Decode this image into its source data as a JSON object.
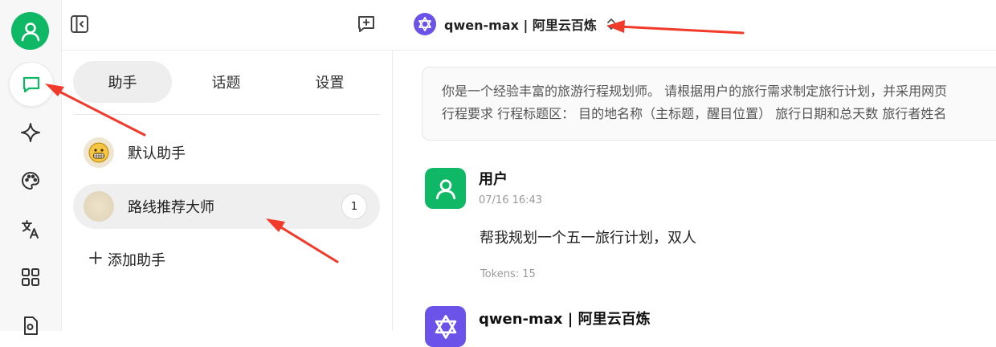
{
  "colors": {
    "brand_green": "#0fb865",
    "model_purple": "#6b52e8",
    "annotation_red": "#f23a2b"
  },
  "sidebar_rail": {
    "icons": [
      "user-avatar-icon",
      "chat-bubble-icon",
      "sparkle-icon",
      "palette-icon",
      "translate-icon",
      "apps-grid-icon",
      "file-search-icon"
    ]
  },
  "header": {
    "model_name": "qwen-max | 阿里云百炼",
    "model_icon": "qwen-logo-icon",
    "switch_icon": "chevron-updown-icon"
  },
  "panel": {
    "tabs": [
      {
        "label": "助手",
        "active": true
      },
      {
        "label": "话题",
        "active": false
      },
      {
        "label": "设置",
        "active": false
      }
    ],
    "assistants": [
      {
        "name": "默认助手",
        "avatar": "grinning-face-icon",
        "selected": false
      },
      {
        "name": "路线推荐大师",
        "avatar": "blurred-avatar",
        "selected": true,
        "count": "1"
      }
    ],
    "add_label": "添加助手"
  },
  "chat": {
    "system_prompt_line1": "你是一个经验丰富的旅游行程规划师。 请根据用户的旅行需求制定旅行计划，并采用网页",
    "system_prompt_line2": "行程要求 行程标题区： 目的地名称（主标题，醒目位置） 旅行日期和总天数 旅行者姓名",
    "messages": [
      {
        "role": "user",
        "author": "用户",
        "time": "07/16 16:43",
        "text": "帮我规划一个五一旅行计划，双人",
        "tokens": "Tokens: 15"
      },
      {
        "role": "assistant",
        "author": "qwen-max | 阿里云百炼"
      }
    ]
  }
}
